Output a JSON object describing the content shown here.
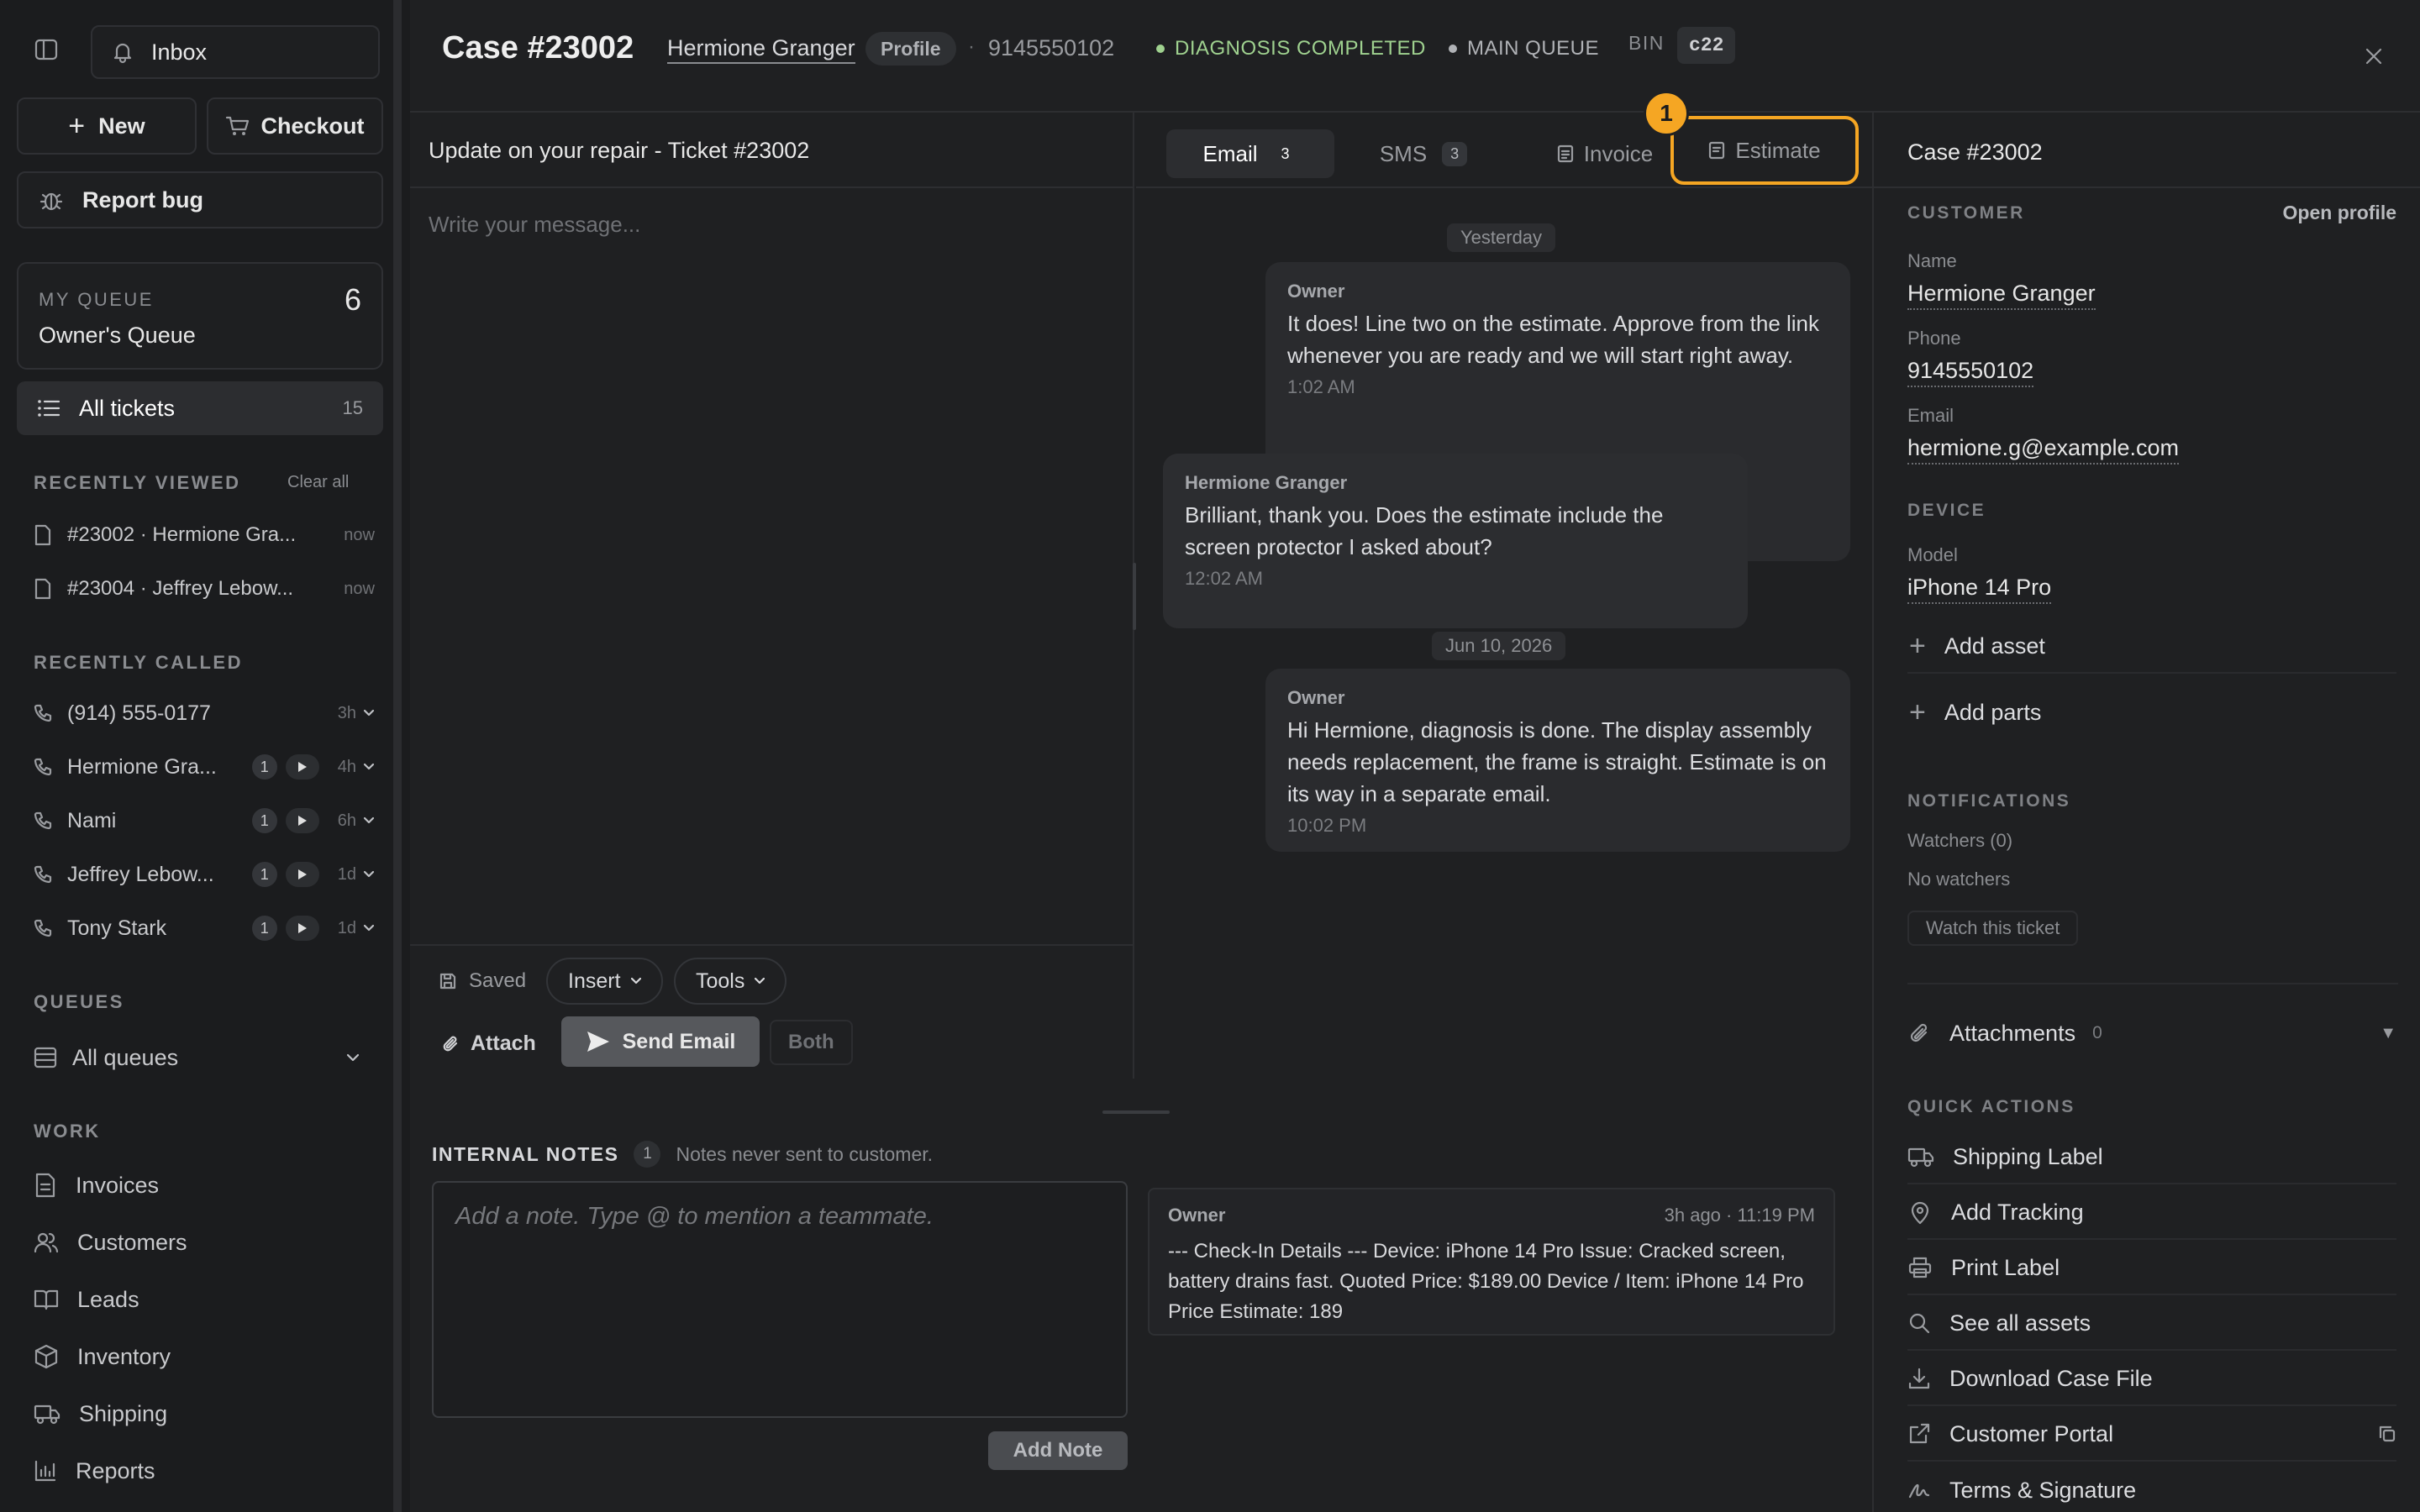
{
  "sidebar": {
    "inbox_label": "Inbox",
    "new_label": "New",
    "checkout_label": "Checkout",
    "report_bug_label": "Report bug",
    "my_queue": {
      "title": "MY QUEUE",
      "name": "Owner's Queue",
      "count": "6"
    },
    "all_tickets": {
      "label": "All tickets",
      "count": "15"
    },
    "recently_viewed": {
      "title": "RECENTLY VIEWED",
      "clear_label": "Clear all",
      "items": [
        {
          "label": "#23002 · Hermione Gra...",
          "time": "now"
        },
        {
          "label": "#23004 · Jeffrey Lebow...",
          "time": "now"
        }
      ]
    },
    "recently_called": {
      "title": "RECENTLY CALLED",
      "items": [
        {
          "name": "(914) 555-0177",
          "count": "",
          "time": "3h"
        },
        {
          "name": "Hermione Gra...",
          "count": "1",
          "time": "4h"
        },
        {
          "name": "Nami",
          "count": "1",
          "time": "6h"
        },
        {
          "name": "Jeffrey Lebow...",
          "count": "1",
          "time": "1d"
        },
        {
          "name": "Tony Stark",
          "count": "1",
          "time": "1d"
        }
      ]
    },
    "queues": {
      "title": "QUEUES",
      "all_label": "All queues"
    },
    "work": {
      "title": "WORK",
      "items": [
        {
          "label": "Invoices",
          "icon": "invoice-icon"
        },
        {
          "label": "Customers",
          "icon": "users-icon"
        },
        {
          "label": "Leads",
          "icon": "book-icon"
        },
        {
          "label": "Inventory",
          "icon": "box-icon"
        },
        {
          "label": "Shipping",
          "icon": "truck-icon"
        },
        {
          "label": "Reports",
          "icon": "chart-icon"
        }
      ]
    }
  },
  "header": {
    "case_title": "Case #23002",
    "customer_name": "Hermione Granger",
    "profile_label": "Profile",
    "separator": "·",
    "phone": "9145550102",
    "status": "DIAGNOSIS COMPLETED",
    "queue": "MAIN QUEUE",
    "bin_label": "BIN",
    "bin_value": "c22",
    "status_color": "#9fd18f",
    "accent_color": "#f5a623"
  },
  "compose": {
    "subject": "Update on your repair - Ticket #23002",
    "placeholder": "Write your message...",
    "saved_label": "Saved",
    "insert_label": "Insert",
    "tools_label": "Tools",
    "attach_label": "Attach",
    "send_label": "Send Email",
    "both_label": "Both"
  },
  "tabs": {
    "email": {
      "label": "Email",
      "count": "3"
    },
    "sms": {
      "label": "SMS",
      "count": "3"
    },
    "invoice": {
      "label": "Invoice"
    },
    "estimate": {
      "label": "Estimate"
    },
    "highlight_number": "1"
  },
  "conversation": {
    "date1": "Yesterday",
    "date2": "Jun 10, 2026",
    "messages": [
      {
        "author": "Owner",
        "text": "It does! Line two on the estimate. Approve from the link whenever you are ready and we will start right away.",
        "time": "1:02 AM"
      },
      {
        "author": "Hermione Granger",
        "text": "Brilliant, thank you. Does the estimate include the screen protector I asked about?",
        "time": "12:02 AM"
      },
      {
        "author": "Owner",
        "text": "Hi Hermione, diagnosis is done. The display assembly needs replacement, the frame is straight. Estimate is on its way in a separate email.",
        "time": "10:02 PM"
      }
    ]
  },
  "notes": {
    "title": "INTERNAL NOTES",
    "count": "1",
    "hint": "Notes never sent to customer.",
    "placeholder": "Add a note. Type @ to mention a teammate.",
    "add_label": "Add Note",
    "entry": {
      "author": "Owner",
      "time": "3h ago · 11:19 PM",
      "text": "--- Check-In Details --- Device: iPhone 14 Pro Issue: Cracked screen, battery drains fast. Quoted Price: $189.00 Device / Item: iPhone 14 Pro Price Estimate: 189"
    }
  },
  "panel": {
    "case_title": "Case #23002",
    "customer_section": "CUSTOMER",
    "open_profile": "Open profile",
    "name_label": "Name",
    "name": "Hermione Granger",
    "phone_label": "Phone",
    "phone": "9145550102",
    "email_label": "Email",
    "email": "hermione.g@example.com",
    "device_section": "DEVICE",
    "model_label": "Model",
    "model": "iPhone 14 Pro",
    "add_asset": "Add asset",
    "add_parts": "Add parts",
    "notifications_section": "NOTIFICATIONS",
    "watchers": "Watchers (0)",
    "no_watchers": "No watchers",
    "watch_button": "Watch this ticket",
    "attachments_label": "Attachments",
    "attachments_count": "0",
    "quick_actions_section": "QUICK ACTIONS",
    "quick_actions": [
      {
        "label": "Shipping Label",
        "icon": "truck-icon"
      },
      {
        "label": "Add Tracking",
        "icon": "map-pin-icon"
      },
      {
        "label": "Print Label",
        "icon": "printer-icon"
      },
      {
        "label": "See all assets",
        "icon": "search-icon"
      },
      {
        "label": "Download Case File",
        "icon": "download-icon"
      },
      {
        "label": "Customer Portal",
        "icon": "external-link-icon"
      },
      {
        "label": "Terms & Signature",
        "icon": "signature-icon"
      }
    ]
  }
}
